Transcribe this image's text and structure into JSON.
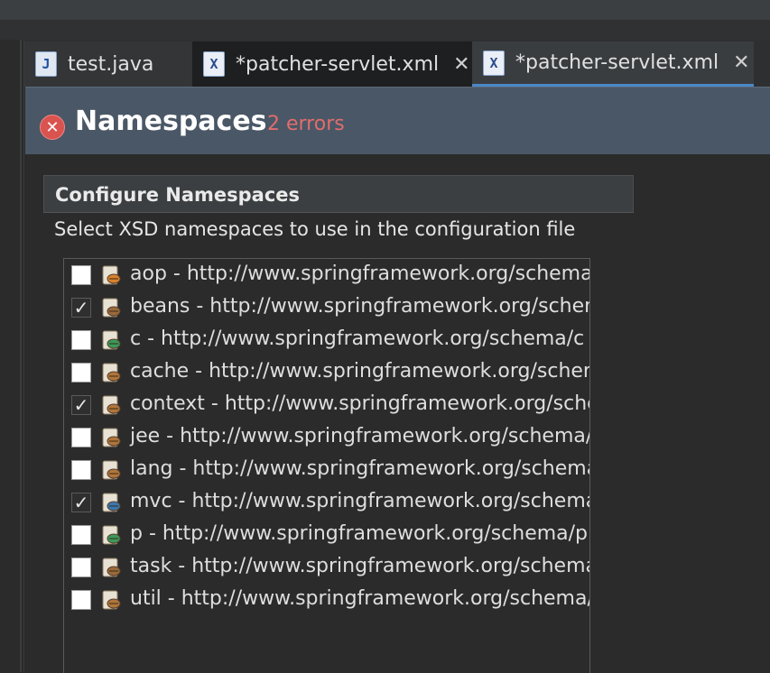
{
  "tabs": [
    {
      "label": "test.java",
      "icon": "java-file-icon",
      "closable": false
    },
    {
      "label": "*patcher-servlet.xml",
      "icon": "xml-file-icon",
      "closable": true
    },
    {
      "label": "*patcher-servlet.xml",
      "icon": "spring-xml-file-icon",
      "closable": true
    }
  ],
  "header": {
    "title": "Namespaces",
    "error_count": "2 errors",
    "error_icon_glyph": "✕"
  },
  "section": {
    "title": "Configure Namespaces",
    "description": "Select XSD namespaces to use in the configuration file"
  },
  "namespaces": [
    {
      "label": "aop - http://www.springframework.org/schema/aop",
      "checked": false,
      "icon": "aop-icon",
      "color": "#d9822b"
    },
    {
      "label": "beans - http://www.springframework.org/schema/beans",
      "checked": true,
      "icon": "beans-icon",
      "color": "#9a6a3a"
    },
    {
      "label": "c - http://www.springframework.org/schema/c",
      "checked": false,
      "icon": "c-namespace-icon",
      "color": "#3a9a5a"
    },
    {
      "label": "cache - http://www.springframework.org/schema/cache",
      "checked": false,
      "icon": "cache-icon",
      "color": "#b0763a"
    },
    {
      "label": "context - http://www.springframework.org/schema/context",
      "checked": true,
      "icon": "context-icon",
      "color": "#b0763a"
    },
    {
      "label": "jee - http://www.springframework.org/schema/jee",
      "checked": false,
      "icon": "jee-icon",
      "color": "#b0763a"
    },
    {
      "label": "lang - http://www.springframework.org/schema/lang",
      "checked": false,
      "icon": "lang-icon",
      "color": "#b0763a"
    },
    {
      "label": "mvc - http://www.springframework.org/schema/mvc",
      "checked": true,
      "icon": "mvc-globe-icon",
      "color": "#3a78b0"
    },
    {
      "label": "p - http://www.springframework.org/schema/p",
      "checked": false,
      "icon": "p-namespace-icon",
      "color": "#3a9a5a"
    },
    {
      "label": "task - http://www.springframework.org/schema/task",
      "checked": false,
      "icon": "task-icon",
      "color": "#9a6a3a"
    },
    {
      "label": "util - http://www.springframework.org/schema/util",
      "checked": false,
      "icon": "util-icon",
      "color": "#b0763a"
    }
  ]
}
